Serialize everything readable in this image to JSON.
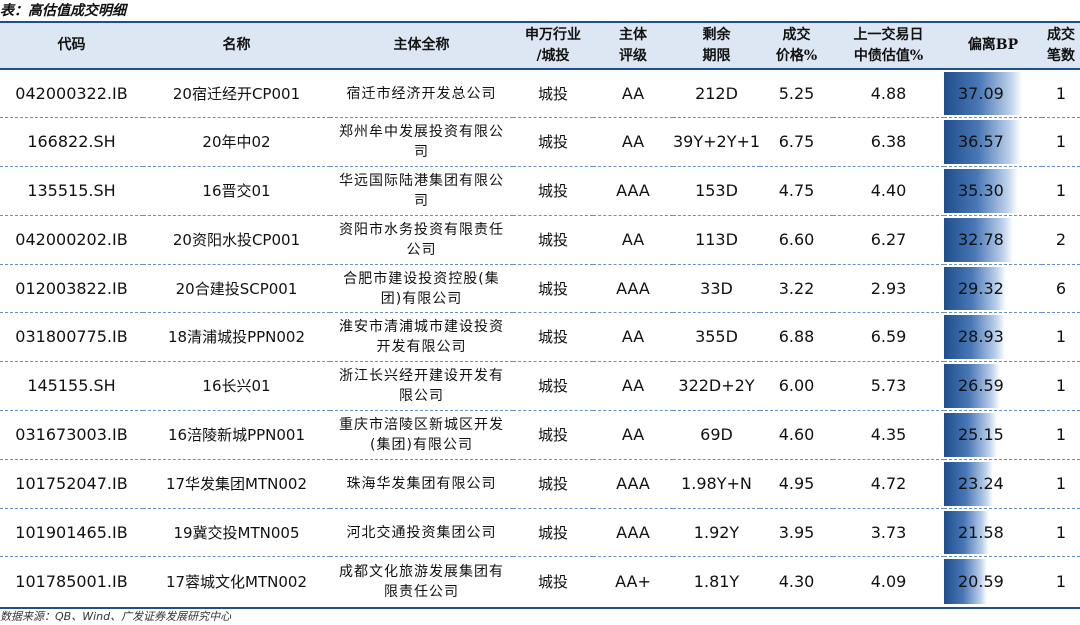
{
  "caption": "表：高估值成交明细",
  "headers": {
    "code": "代码",
    "name": "名称",
    "entity": "主体全称",
    "industry_l1": "申万行业",
    "industry_l2": "/城投",
    "rating_l1": "主体",
    "rating_l2": "评级",
    "term_l1": "剩余",
    "term_l2": "期限",
    "price_l1": "成交",
    "price_l2": "价格%",
    "valuation_l1": "上一交易日",
    "valuation_l2": "中债估值%",
    "deviation": "偏离BP",
    "count_l1": "成交",
    "count_l2": "笔数"
  },
  "bar_max": 37.09,
  "rows": [
    {
      "code": "042000322.IB",
      "name": "20宿迁经开CP001",
      "entity": "宿迁市经济开发总公司",
      "industry": "城投",
      "rating": "AA",
      "term": "212D",
      "price": "5.25",
      "valuation": "4.88",
      "deviation": "37.09",
      "count": "1"
    },
    {
      "code": "166822.SH",
      "name": "20年中02",
      "entity": "郑州牟中发展投资有限公司",
      "industry": "城投",
      "rating": "AA",
      "term": "39Y+2Y+1",
      "price": "6.75",
      "valuation": "6.38",
      "deviation": "36.57",
      "count": "1"
    },
    {
      "code": "135515.SH",
      "name": "16晋交01",
      "entity": "华远国际陆港集团有限公司",
      "industry": "城投",
      "rating": "AAA",
      "term": "153D",
      "price": "4.75",
      "valuation": "4.40",
      "deviation": "35.30",
      "count": "1"
    },
    {
      "code": "042000202.IB",
      "name": "20资阳水投CP001",
      "entity": "资阳市水务投资有限责任公司",
      "industry": "城投",
      "rating": "AA",
      "term": "113D",
      "price": "6.60",
      "valuation": "6.27",
      "deviation": "32.78",
      "count": "2"
    },
    {
      "code": "012003822.IB",
      "name": "20合建投SCP001",
      "entity": "合肥市建设投资控股(集团)有限公司",
      "industry": "城投",
      "rating": "AAA",
      "term": "33D",
      "price": "3.22",
      "valuation": "2.93",
      "deviation": "29.32",
      "count": "6"
    },
    {
      "code": "031800775.IB",
      "name": "18清浦城投PPN002",
      "entity": "淮安市清浦城市建设投资开发有限公司",
      "industry": "城投",
      "rating": "AA",
      "term": "355D",
      "price": "6.88",
      "valuation": "6.59",
      "deviation": "28.93",
      "count": "1"
    },
    {
      "code": "145155.SH",
      "name": "16长兴01",
      "entity": "浙江长兴经开建设开发有限公司",
      "industry": "城投",
      "rating": "AA",
      "term": "322D+2Y",
      "price": "6.00",
      "valuation": "5.73",
      "deviation": "26.59",
      "count": "1"
    },
    {
      "code": "031673003.IB",
      "name": "16涪陵新城PPN001",
      "entity": "重庆市涪陵区新城区开发(集团)有限公司",
      "industry": "城投",
      "rating": "AA",
      "term": "69D",
      "price": "4.60",
      "valuation": "4.35",
      "deviation": "25.15",
      "count": "1"
    },
    {
      "code": "101752047.IB",
      "name": "17华发集团MTN002",
      "entity": "珠海华发集团有限公司",
      "industry": "城投",
      "rating": "AAA",
      "term": "1.98Y+N",
      "price": "4.95",
      "valuation": "4.72",
      "deviation": "23.24",
      "count": "1"
    },
    {
      "code": "101901465.IB",
      "name": "19冀交投MTN005",
      "entity": "河北交通投资集团公司",
      "industry": "城投",
      "rating": "AAA",
      "term": "1.92Y",
      "price": "3.95",
      "valuation": "3.73",
      "deviation": "21.58",
      "count": "1"
    },
    {
      "code": "101785001.IB",
      "name": "17蓉城文化MTN002",
      "entity": "成都文化旅游发展集团有限责任公司",
      "industry": "城投",
      "rating": "AA+",
      "term": "1.81Y",
      "price": "4.30",
      "valuation": "4.09",
      "deviation": "20.59",
      "count": "1"
    }
  ],
  "source": "数据来源：QB、Wind、广发证券发展研究中心"
}
